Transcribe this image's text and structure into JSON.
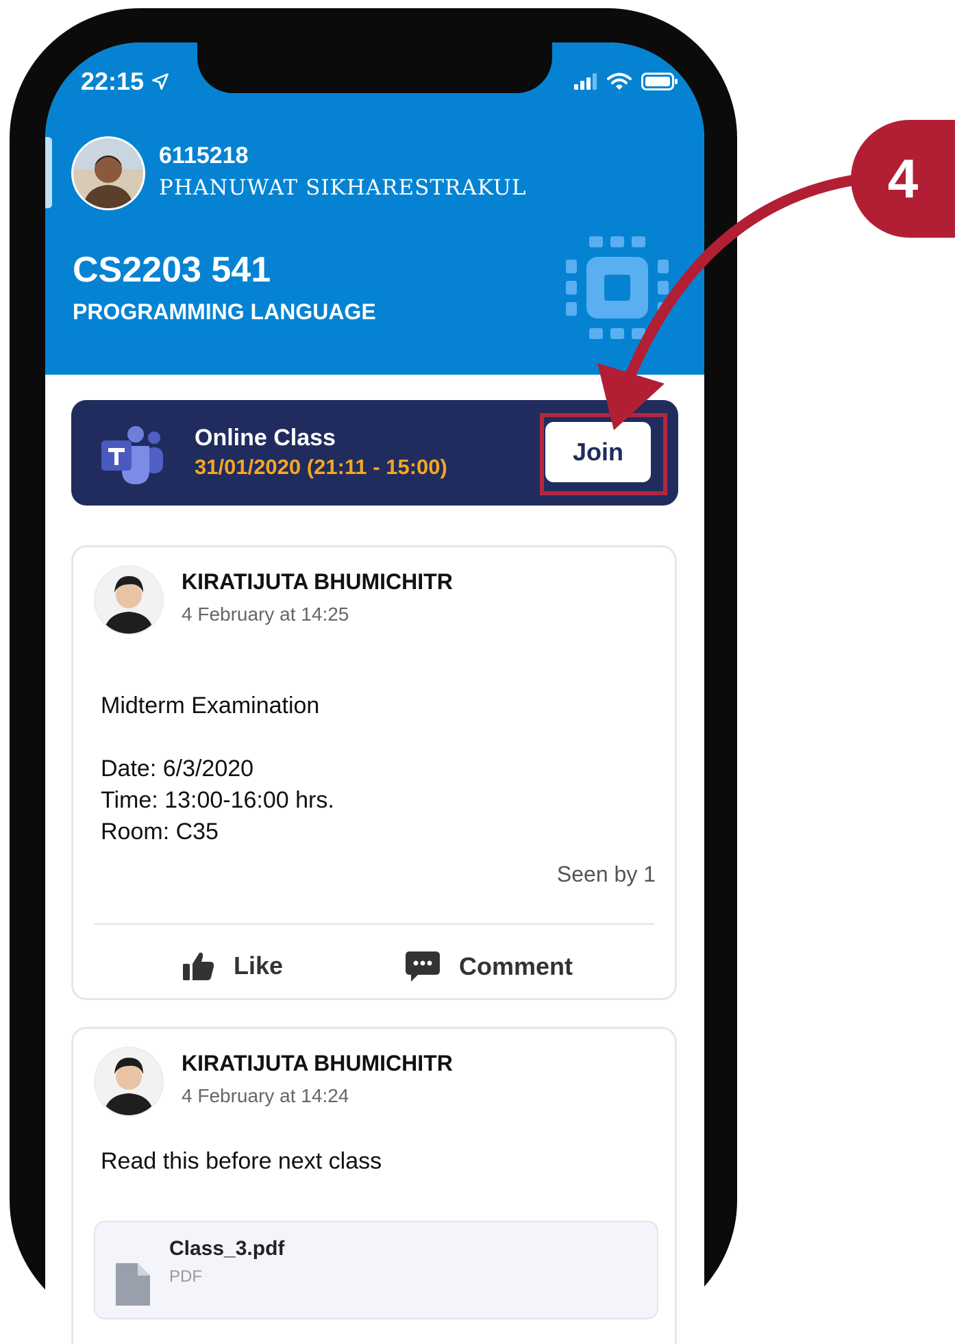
{
  "status_bar": {
    "time": "22:15"
  },
  "profile": {
    "student_id": "6115218",
    "name": "PHANUWAT SIKHARESTRAKUL"
  },
  "course": {
    "code": "CS2203  541",
    "name": "PROGRAMMING LANGUAGE"
  },
  "online_class": {
    "title": "Online Class",
    "schedule": "31/01/2020 (21:11 - 15:00)",
    "join_label": "Join"
  },
  "step_badge": "4",
  "posts": [
    {
      "author": "KIRATIJUTA BHUMICHITR",
      "time": "4 February at 14:25",
      "body": "Midterm Examination\n\nDate: 6/3/2020\nTime: 13:00-16:00 hrs.\nRoom: C35",
      "seen": "Seen by 1",
      "like_label": "Like",
      "comment_label": "Comment"
    },
    {
      "author": "KIRATIJUTA BHUMICHITR",
      "time": "4 February at 14:24",
      "body": "Read this before next class",
      "attachment": {
        "name": "Class_3.pdf",
        "type": "PDF"
      }
    }
  ],
  "colors": {
    "header_blue": "#0583d2",
    "online_class_bg": "#212c5e",
    "schedule_orange": "#f5a623",
    "highlight_red": "#b3263f"
  }
}
